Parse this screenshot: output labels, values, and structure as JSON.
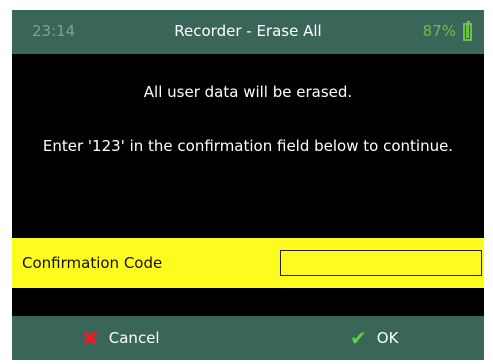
{
  "status_bar": {
    "time": "23:14",
    "title": "Recorder - Erase All",
    "battery_percent": "87%",
    "battery_icon": "battery-icon"
  },
  "message": {
    "line1": "All user data will be erased.",
    "line2": "Enter '123' in the confirmation field below to continue."
  },
  "confirmation": {
    "label": "Confirmation Code",
    "value": ""
  },
  "buttons": {
    "cancel": {
      "label": "Cancel",
      "icon": "x-icon",
      "color": "#ee1d24"
    },
    "ok": {
      "label": "OK",
      "icon": "check-icon",
      "color": "#5fd13b"
    }
  },
  "colors": {
    "bar": "#3a6659",
    "highlight": "#fffb1f",
    "battery": "#6cc04a"
  }
}
